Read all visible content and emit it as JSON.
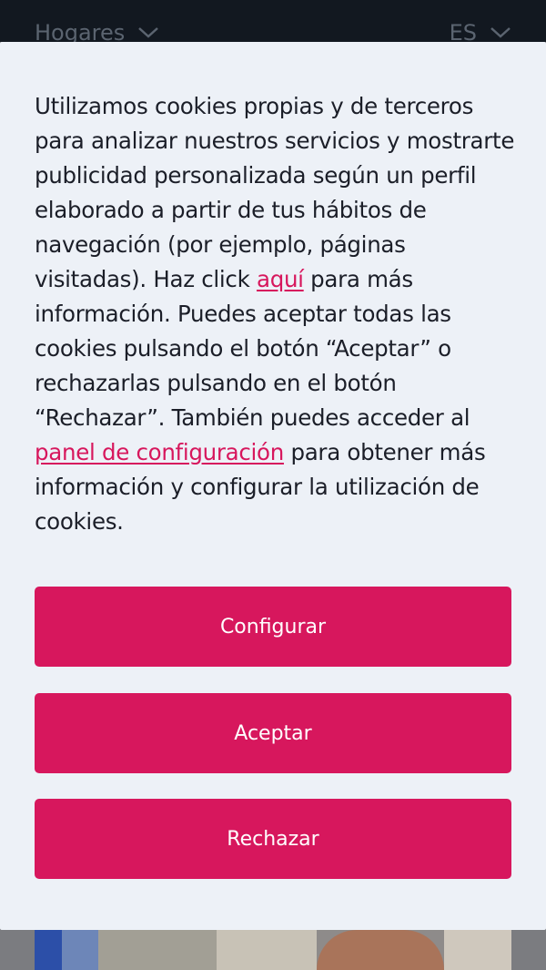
{
  "topbar": {
    "left_label": "Hogares",
    "right_label": "ES"
  },
  "banner": {
    "text_parts": {
      "p1": "Utilizamos cookies propias y de terceros para analizar nuestros servicios y mostrarte publicidad personalizada según un perfil elaborado a partir de tus hábitos de navegación (por ejemplo, páginas visitadas). Haz click ",
      "link1": "aquí",
      "p2": " para más información. Puedes aceptar todas las cookies pulsando el botón “Aceptar” o rechazarlas pulsando en el botón “Rechazar”. También puedes acceder al ",
      "link2": "panel de configuración",
      "p3": " para obtener más información y configurar la utilización de cookies."
    },
    "buttons": {
      "configure": "Configurar",
      "accept": "Aceptar",
      "reject": "Rechazar"
    }
  },
  "colors": {
    "accent": "#d7175d",
    "banner_bg": "#edf1f7",
    "topbar_bg": "#121820"
  },
  "icons": {
    "dropdown": "chevron-down-icon"
  }
}
